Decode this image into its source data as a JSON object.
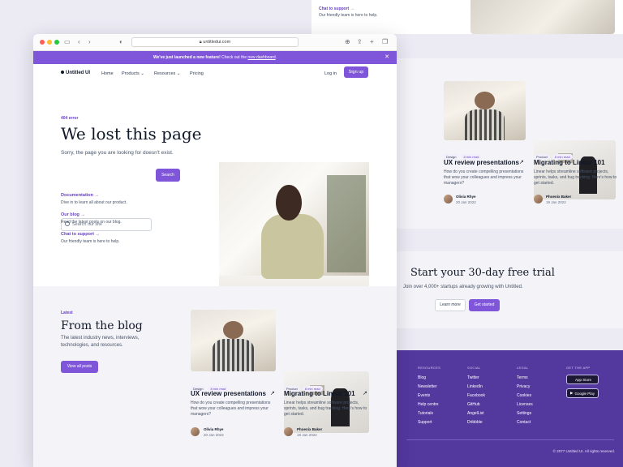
{
  "bg_top": {
    "chat_link": "Chat to support →",
    "chat_desc": "Our friendly team is here to help."
  },
  "bg_blog": {
    "posts": [
      {
        "tag1": "Design",
        "tag2": "8 min read",
        "title": "UX review presentations",
        "desc": "How do you create compelling presentations that wow your colleagues and impress your managers?",
        "author": "Olivia Rhye",
        "date": "20 Jan 2022"
      },
      {
        "tag1": "Product",
        "tag2": "8 min read",
        "title": "Migrating to Linear 101",
        "desc": "Linear helps streamline software projects, sprints, tasks, and bug tracking. Here's how to get started.",
        "author": "Phoenix Baker",
        "date": "19 Jan 2022"
      }
    ]
  },
  "cta": {
    "title": "Start your 30-day free trial",
    "sub": "Join over 4,000+ startups already growing with Untitled.",
    "learn_more": "Learn more",
    "get_started": "Get started"
  },
  "footer": {
    "columns": [
      {
        "heading": "RESOURCES",
        "links": [
          "Blog",
          "Newsletter",
          "Events",
          "Help centre",
          "Tutorials",
          "Support"
        ]
      },
      {
        "heading": "SOCIAL",
        "links": [
          "Twitter",
          "LinkedIn",
          "Facebook",
          "GitHub",
          "AngelList",
          "Dribbble"
        ]
      },
      {
        "heading": "LEGAL",
        "links": [
          "Terms",
          "Privacy",
          "Cookies",
          "Licenses",
          "Settings",
          "Contact"
        ]
      }
    ],
    "app_heading": "GET THE APP",
    "app_store": "App Store",
    "google_play": "Google Play",
    "copyright": "© 2077 Untitled UI. All rights reserved."
  },
  "browser": {
    "url": "untitledui.com"
  },
  "banner": {
    "bold": "We've just launched a new feature!",
    "text": " Check out the ",
    "link": "new dashboard",
    "end": "."
  },
  "nav": {
    "logo": "Untitled UI",
    "items": [
      "Home",
      "Products",
      "Resources",
      "Pricing"
    ],
    "login": "Log in",
    "signup": "Sign up"
  },
  "hero": {
    "kicker": "404 error",
    "title": "We lost this page",
    "sub": "Sorry, the page you are looking for doesn't exist.",
    "search_placeholder": "Search our site",
    "search_button": "Search",
    "links": [
      {
        "label": "Documentation →",
        "desc": "Dive in to learn all about our product."
      },
      {
        "label": "Our blog →",
        "desc": "Read the latest posts on our blog."
      },
      {
        "label": "Chat to support →",
        "desc": "Our friendly team is here to help."
      }
    ]
  },
  "blog": {
    "kicker": "Latest",
    "title": "From the blog",
    "sub": "The latest industry news, interviews, technologies, and resources.",
    "view_all": "View all posts"
  },
  "colors": {
    "brand": "#7f56d9",
    "brand_dark": "#53389e",
    "accent_text": "#6941c6"
  }
}
